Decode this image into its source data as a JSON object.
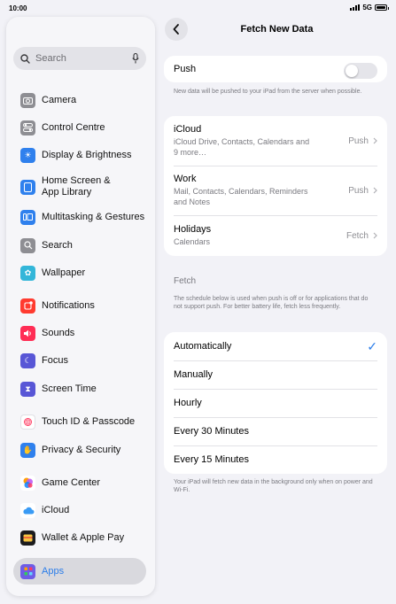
{
  "status": {
    "time": "10:00",
    "network": "5G"
  },
  "sidebar": {
    "search": {
      "placeholder": "Search"
    },
    "items": [
      {
        "label": "Camera",
        "icon": "camera-icon",
        "color": "#8e8e93"
      },
      {
        "label": "Control Centre",
        "icon": "control-centre-icon",
        "color": "#8e8e93"
      },
      {
        "label": "Display & Brightness",
        "icon": "sun-icon",
        "color": "#2f80ed"
      },
      {
        "label": "Home Screen & App Library",
        "line1": "Home Screen &",
        "line2": "App Library",
        "icon": "home-screen-icon",
        "color": "#2f80ed"
      },
      {
        "label": "Multitasking & Gestures",
        "icon": "multitasking-icon",
        "color": "#2f80ed"
      },
      {
        "label": "Search",
        "icon": "search-icon",
        "color": "#8e8e93"
      },
      {
        "label": "Wallpaper",
        "icon": "wallpaper-icon",
        "color": "#33b6d9"
      },
      {
        "label": "Notifications",
        "icon": "bell-icon",
        "color": "#ff3b30"
      },
      {
        "label": "Sounds",
        "icon": "speaker-icon",
        "color": "#ff2d55"
      },
      {
        "label": "Focus",
        "icon": "moon-icon",
        "color": "#5856d6"
      },
      {
        "label": "Screen Time",
        "icon": "hourglass-icon",
        "color": "#5856d6"
      },
      {
        "label": "Touch ID & Passcode",
        "icon": "fingerprint-icon",
        "color": "#ffffff"
      },
      {
        "label": "Privacy & Security",
        "icon": "hand-icon",
        "color": "#2f80ed"
      },
      {
        "label": "Game Center",
        "icon": "game-center-icon",
        "color": "#ffffff"
      },
      {
        "label": "iCloud",
        "icon": "cloud-icon",
        "color": "#ffffff"
      },
      {
        "label": "Wallet & Apple Pay",
        "icon": "wallet-icon",
        "color": "#1c1c1e"
      },
      {
        "label": "Apps",
        "icon": "apps-icon",
        "color": "#6e5ce6"
      }
    ]
  },
  "header": {
    "title": "Fetch New Data",
    "back_icon": "chevron-left-icon"
  },
  "push": {
    "label": "Push",
    "enabled": false,
    "footnote": "New data will be pushed to your iPad from the server when possible."
  },
  "accounts": [
    {
      "name": "iCloud",
      "detail": "iCloud Drive, Contacts, Calendars and 9 more…",
      "value": "Push"
    },
    {
      "name": "Work",
      "detail": "Mail, Contacts, Calendars, Reminders and Notes",
      "value": "Push"
    },
    {
      "name": "Holidays",
      "detail": "Calendars",
      "value": "Fetch"
    }
  ],
  "fetch": {
    "heading": "Fetch",
    "description": "The schedule below is used when push is off or for applications that do not support push. For better battery life, fetch less frequently.",
    "options": [
      "Automatically",
      "Manually",
      "Hourly",
      "Every 30 Minutes",
      "Every 15 Minutes"
    ],
    "selected": "Automatically",
    "footnote": "Your iPad will fetch new data in the background only when on power and Wi-Fi."
  },
  "colors": {
    "accent": "#2b7de9",
    "background": "#f2f2f7"
  }
}
